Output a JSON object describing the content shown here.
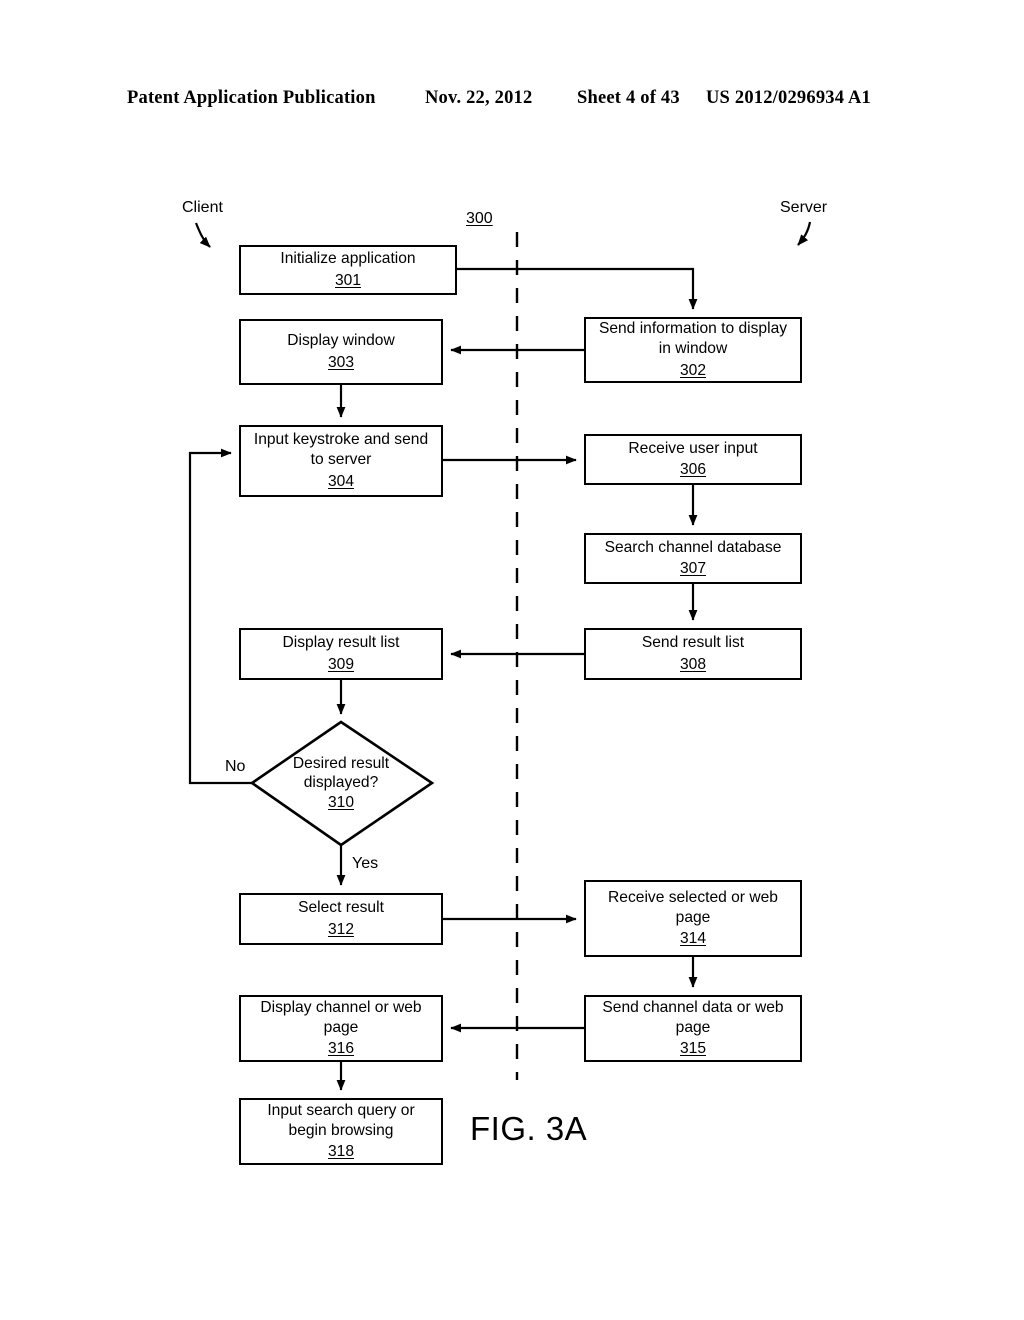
{
  "header": {
    "publication": "Patent Application Publication",
    "date": "Nov. 22, 2012",
    "sheet": "Sheet 4 of 43",
    "patent_number": "US 2012/0296934 A1"
  },
  "figure": {
    "name": "FIG. 3A",
    "diagram_ref": "300",
    "lane_left_label": "Client",
    "lane_right_label": "Server",
    "branch_no": "No",
    "branch_yes": "Yes"
  },
  "nodes": {
    "n301": {
      "text": "Initialize application",
      "ref": "301"
    },
    "n302": {
      "text": "Send information to display\nin window",
      "ref": "302"
    },
    "n303": {
      "text": "Display window",
      "ref": "303"
    },
    "n304": {
      "text": "Input keystroke and send\nto server",
      "ref": "304"
    },
    "n306": {
      "text": "Receive user input",
      "ref": "306"
    },
    "n307": {
      "text": "Search channel database",
      "ref": "307"
    },
    "n308": {
      "text": "Send result list",
      "ref": "308"
    },
    "n309": {
      "text": "Display result list",
      "ref": "309"
    },
    "n310": {
      "text": "Desired result\ndisplayed?",
      "ref": "310"
    },
    "n312": {
      "text": "Select result",
      "ref": "312"
    },
    "n314": {
      "text": "Receive selected or web\npage",
      "ref": "314"
    },
    "n315": {
      "text": "Send channel data or web\npage",
      "ref": "315"
    },
    "n316": {
      "text": "Display channel or web\npage",
      "ref": "316"
    },
    "n318": {
      "text": "Input search query or\nbegin browsing",
      "ref": "318"
    }
  },
  "chart_data": {
    "type": "diagram",
    "title": "FIG. 3A",
    "diagram_kind": "swimlane-flowchart",
    "lanes": [
      "Client",
      "Server"
    ],
    "divider": "vertical dashed line separating Client (left) and Server (right)",
    "steps": [
      {
        "id": "301",
        "lane": "Client",
        "shape": "process",
        "label": "Initialize application"
      },
      {
        "id": "302",
        "lane": "Server",
        "shape": "process",
        "label": "Send information to display in window"
      },
      {
        "id": "303",
        "lane": "Client",
        "shape": "process",
        "label": "Display window"
      },
      {
        "id": "304",
        "lane": "Client",
        "shape": "process",
        "label": "Input keystroke and send to server"
      },
      {
        "id": "306",
        "lane": "Server",
        "shape": "process",
        "label": "Receive user input"
      },
      {
        "id": "307",
        "lane": "Server",
        "shape": "process",
        "label": "Search channel database"
      },
      {
        "id": "308",
        "lane": "Server",
        "shape": "process",
        "label": "Send result list"
      },
      {
        "id": "309",
        "lane": "Client",
        "shape": "process",
        "label": "Display result list"
      },
      {
        "id": "310",
        "lane": "Client",
        "shape": "decision",
        "label": "Desired result displayed?"
      },
      {
        "id": "312",
        "lane": "Client",
        "shape": "process",
        "label": "Select result"
      },
      {
        "id": "314",
        "lane": "Server",
        "shape": "process",
        "label": "Receive selected or web page"
      },
      {
        "id": "315",
        "lane": "Server",
        "shape": "process",
        "label": "Send channel data or web page"
      },
      {
        "id": "316",
        "lane": "Client",
        "shape": "process",
        "label": "Display channel or web page"
      },
      {
        "id": "318",
        "lane": "Client",
        "shape": "process",
        "label": "Input search query or begin browsing"
      }
    ],
    "edges": [
      {
        "from": "301",
        "to": "302",
        "label": ""
      },
      {
        "from": "302",
        "to": "303",
        "label": ""
      },
      {
        "from": "303",
        "to": "304",
        "label": ""
      },
      {
        "from": "304",
        "to": "306",
        "label": ""
      },
      {
        "from": "306",
        "to": "307",
        "label": ""
      },
      {
        "from": "307",
        "to": "308",
        "label": ""
      },
      {
        "from": "308",
        "to": "309",
        "label": ""
      },
      {
        "from": "309",
        "to": "310",
        "label": ""
      },
      {
        "from": "310",
        "to": "304",
        "label": "No"
      },
      {
        "from": "310",
        "to": "312",
        "label": "Yes"
      },
      {
        "from": "312",
        "to": "314",
        "label": ""
      },
      {
        "from": "314",
        "to": "315",
        "label": ""
      },
      {
        "from": "315",
        "to": "316",
        "label": ""
      },
      {
        "from": "316",
        "to": "318",
        "label": ""
      }
    ]
  }
}
